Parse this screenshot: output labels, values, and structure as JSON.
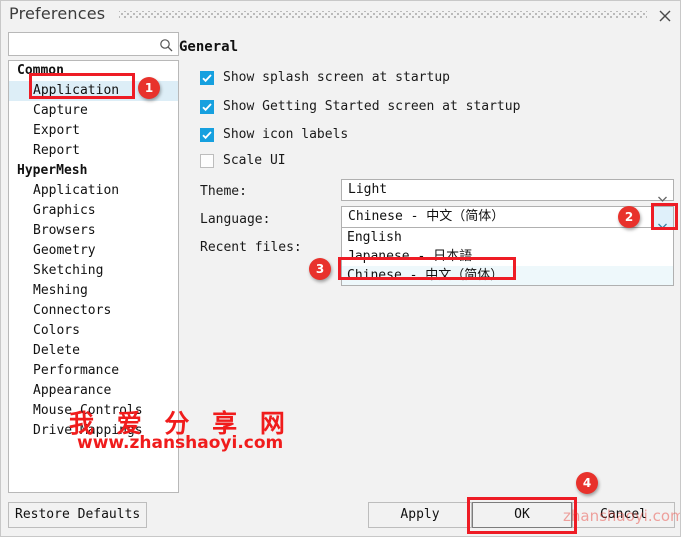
{
  "window": {
    "title": "Preferences",
    "close_icon": "close-icon",
    "grip_icon": "drag-grip-dots"
  },
  "search": {
    "value": "",
    "placeholder": "",
    "icon": "search-icon"
  },
  "sidebar": {
    "groups": [
      {
        "label": "Common",
        "items": [
          {
            "label": "Application",
            "selected": true
          },
          {
            "label": "Capture",
            "selected": false
          },
          {
            "label": "Export",
            "selected": false
          },
          {
            "label": "Report",
            "selected": false
          }
        ]
      },
      {
        "label": "HyperMesh",
        "items": [
          {
            "label": "Application",
            "selected": false
          },
          {
            "label": "Graphics",
            "selected": false
          },
          {
            "label": "Browsers",
            "selected": false
          },
          {
            "label": "Geometry",
            "selected": false
          },
          {
            "label": "Sketching",
            "selected": false
          },
          {
            "label": "Meshing",
            "selected": false
          },
          {
            "label": "Connectors",
            "selected": false
          },
          {
            "label": "Colors",
            "selected": false
          },
          {
            "label": "Delete",
            "selected": false
          },
          {
            "label": "Performance",
            "selected": false
          },
          {
            "label": "Appearance",
            "selected": false
          },
          {
            "label": "Mouse Controls",
            "selected": false
          },
          {
            "label": "Drive Mappings",
            "selected": false
          }
        ]
      }
    ]
  },
  "main": {
    "heading": "General",
    "checkboxes": [
      {
        "label": "Show splash screen at startup",
        "checked": true
      },
      {
        "label": "Show Getting Started screen at startup",
        "checked": true
      },
      {
        "label": "Show icon labels",
        "checked": true
      },
      {
        "label": "Scale UI",
        "checked": false
      }
    ],
    "theme": {
      "label": "Theme:",
      "value": "Light",
      "arrow_icon": "chevron-down-icon"
    },
    "language": {
      "label": "Language:",
      "value": "Chinese - 中文（简体）",
      "arrow_icon": "chevron-down-icon",
      "options": [
        "English",
        "Japanese - 日本語",
        "Chinese - 中文（简体）"
      ],
      "selected_option": "Chinese - 中文（简体）"
    },
    "recent_files": {
      "label": "Recent files:"
    }
  },
  "footer": {
    "restore_defaults": "Restore Defaults",
    "apply": "Apply",
    "ok": "OK",
    "cancel": "Cancel"
  },
  "annotations": {
    "badges": [
      "1",
      "2",
      "3",
      "4"
    ]
  },
  "watermark": {
    "chinese": "我 爱 分 享 网",
    "url": "www.zhanshaoyi.com",
    "faint": "zhanshaoyi.com"
  }
}
